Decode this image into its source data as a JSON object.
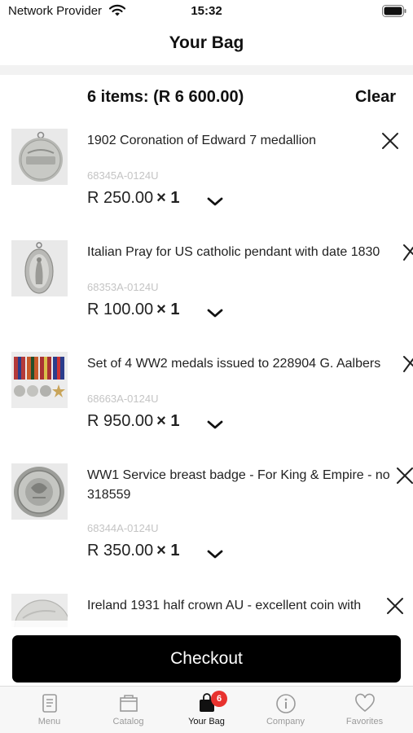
{
  "status_bar": {
    "carrier": "Network Provider",
    "time": "15:32"
  },
  "header": {
    "title": "Your Bag"
  },
  "summary": {
    "count_label": "6 items: (R 6 600.00)",
    "clear_label": "Clear"
  },
  "items": [
    {
      "title": "1902 Coronation of Edward 7 medallion",
      "sku": "68345A-0124U",
      "price": "R 250.00",
      "qty": "× 1"
    },
    {
      "title": "Italian Pray for US catholic pendant with date 1830",
      "sku": "68353A-0124U",
      "price": "R 100.00",
      "qty": "× 1"
    },
    {
      "title": "Set of 4 WW2 medals issued to 228904 G. Aalbers",
      "sku": "68663A-0124U",
      "price": "R 950.00",
      "qty": "× 1"
    },
    {
      "title": "WW1 Service breast badge - For King & Empire - no 318559",
      "sku": "68344A-0124U",
      "price": "R 350.00",
      "qty": "× 1"
    },
    {
      "title": "Ireland 1931 half crown AU - excellent coin with",
      "sku": "",
      "price": "",
      "qty": ""
    }
  ],
  "checkout": {
    "label": "Checkout"
  },
  "tabs": [
    {
      "label": "Menu",
      "icon": "menu-icon"
    },
    {
      "label": "Catalog",
      "icon": "catalog-icon"
    },
    {
      "label": "Your Bag",
      "icon": "bag-icon",
      "badge": "6"
    },
    {
      "label": "Company",
      "icon": "info-icon"
    },
    {
      "label": "Favorites",
      "icon": "heart-icon"
    }
  ],
  "colors": {
    "accent": "#000000",
    "badge": "#e8322e",
    "sku": "#c4c4c4",
    "inactive_tab": "#9a9a9a"
  }
}
